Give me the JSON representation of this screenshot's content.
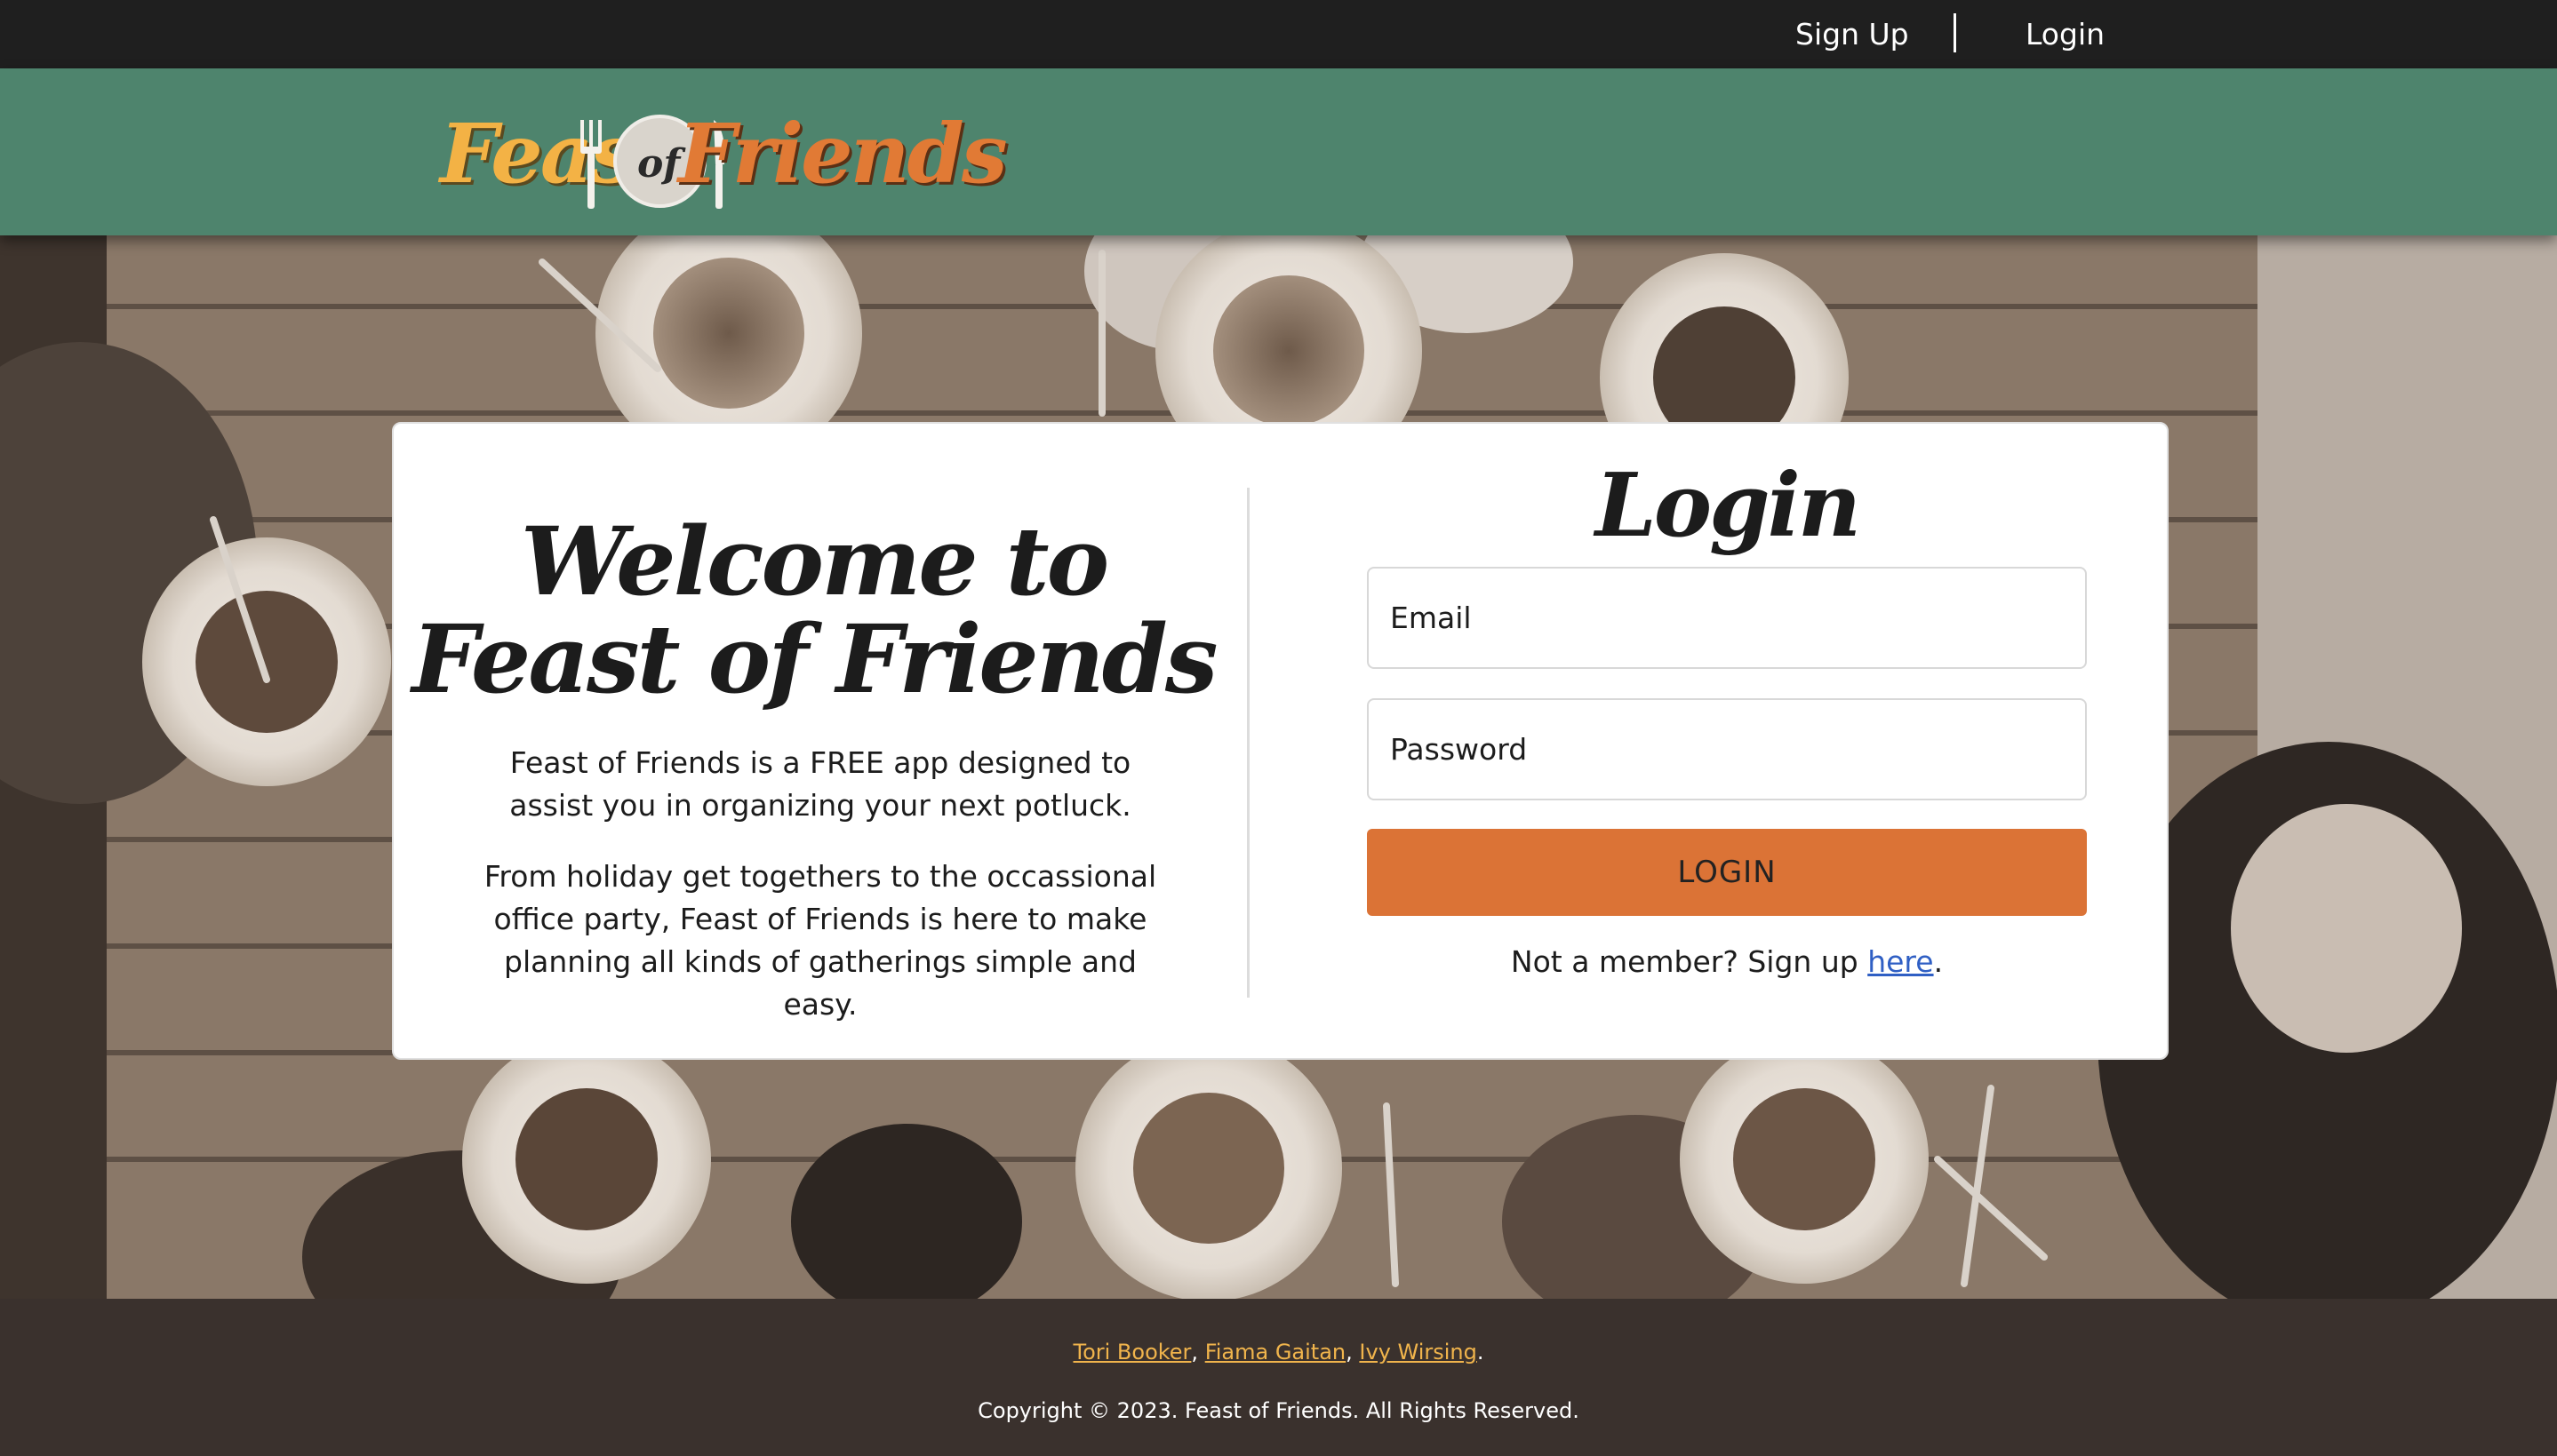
{
  "topnav": {
    "signup_label": "Sign Up",
    "login_label": "Login"
  },
  "header": {
    "logo_word1": "Feast",
    "logo_word2": "of",
    "logo_word3": "Friends"
  },
  "welcome": {
    "line1": "Welcome to",
    "line2": "Feast of Friends",
    "paragraph1": "Feast of Friends is a FREE app designed to assist you in organizing your next potluck.",
    "paragraph2": "From holiday get togethers to the occassional office party, Feast of Friends is here to make planning all kinds of gatherings simple and easy."
  },
  "login": {
    "title": "Login",
    "email_placeholder": "Email",
    "password_placeholder": "Password",
    "button_label": "LOGIN",
    "member_text": "Not a member? Sign up ",
    "member_link": "here",
    "member_suffix": "."
  },
  "footer": {
    "authors": [
      "Tori Booker",
      "Fiama Gaitan",
      "Ivy Wirsing"
    ],
    "separator": ", ",
    "authors_suffix": ".",
    "copyright": "Copyright © 2023. Feast of Friends. All Rights Reserved."
  },
  "colors": {
    "topbar": "#1f1f1f",
    "header": "#4e846d",
    "accent_orange": "#db7336",
    "footer": "#3a312d",
    "link_gold": "#f0b44c",
    "link_blue": "#2f5fc4"
  }
}
